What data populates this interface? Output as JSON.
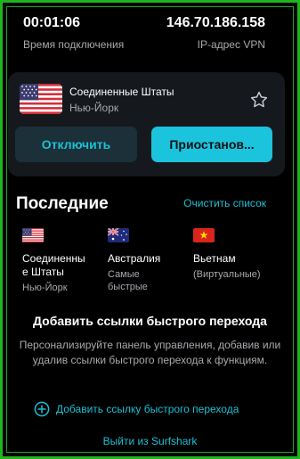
{
  "connection": {
    "duration": "00:01:06",
    "duration_label": "Время подключения",
    "ip": "146.70.186.158",
    "ip_label": "IP-адрес VPN"
  },
  "location": {
    "country": "Соединенные Штаты",
    "city": "Нью-Йорк",
    "flag": "us-flag-icon",
    "favorite_icon": "star-icon"
  },
  "buttons": {
    "disconnect": "Отключить",
    "pause": "Приостанов..."
  },
  "recent": {
    "title": "Последние",
    "clear": "Очистить список",
    "items": [
      {
        "name": "Соединенные Штаты",
        "name_line1": "Соединенны",
        "name_line2": "е Штаты",
        "sub": "Нью-Йорк",
        "flag": "us-flag-icon"
      },
      {
        "name": "Австралия",
        "sub_line1": "Самые",
        "sub_line2": "быстрые",
        "flag": "au-flag-icon"
      },
      {
        "name": "Вьетнам",
        "sub": "(Виртуальные)",
        "flag": "vn-flag-icon"
      }
    ]
  },
  "shortcuts": {
    "title": "Добавить ссылки быстрого перехода",
    "description": "Персонализируйте панель управления, добавив или удалив ссылки быстрого перехода к функциям.",
    "add_label": "Добавить ссылку быстрого перехода",
    "add_icon": "plus-circle-icon"
  },
  "logout": "Выйти из Surfshark",
  "colors": {
    "accent": "#1cc0d4",
    "background": "#000000",
    "card": "#15181d",
    "frame": "#1fb51f"
  }
}
